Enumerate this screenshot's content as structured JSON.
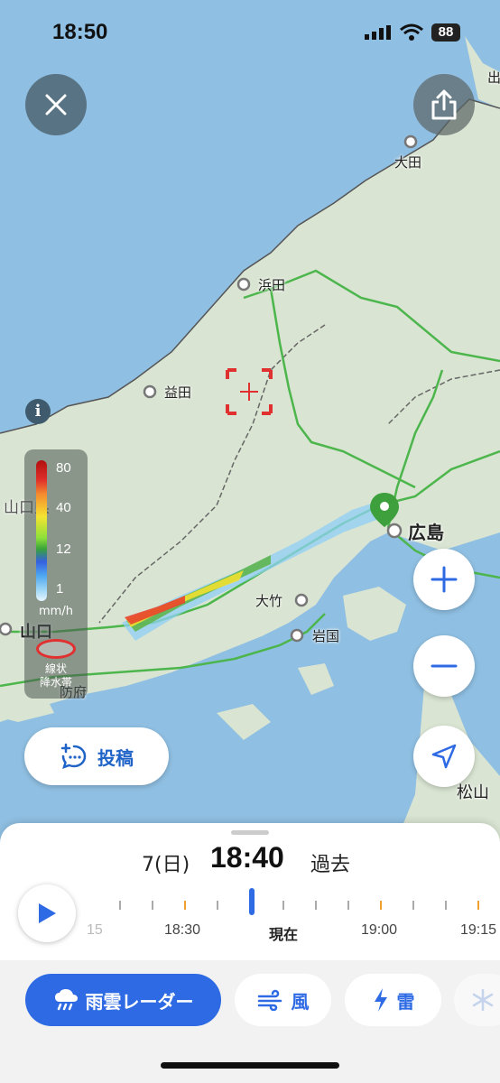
{
  "status_bar": {
    "time": "18:50",
    "battery": "88"
  },
  "map": {
    "cities": [
      {
        "name": "大田"
      },
      {
        "name": "浜田"
      },
      {
        "name": "益田"
      },
      {
        "name": "広島"
      },
      {
        "name": "大竹"
      },
      {
        "name": "岩国"
      },
      {
        "name": "山口"
      },
      {
        "name": "山口県"
      },
      {
        "name": "防府"
      },
      {
        "name": "松山"
      },
      {
        "name": "出"
      }
    ]
  },
  "legend": {
    "ticks": [
      "80",
      "40",
      "12",
      "1"
    ],
    "unit": "mm/h",
    "linear_label_1": "線状",
    "linear_label_2": "降水帯"
  },
  "post_button": {
    "label": "投稿"
  },
  "timeline": {
    "date": "7(日)",
    "time": "18:40",
    "state": "過去",
    "labels": [
      "15",
      "18:30",
      "現在",
      "19:00",
      "19:15"
    ]
  },
  "tabs": [
    {
      "label": "雨雲レーダー",
      "icon": "rain-cloud-icon",
      "active": true
    },
    {
      "label": "風",
      "icon": "wind-icon",
      "active": false
    },
    {
      "label": "雷",
      "icon": "lightning-icon",
      "active": false
    },
    {
      "label": "",
      "icon": "snowflake-icon",
      "active": false
    }
  ],
  "colors": {
    "accent": "#2d6ae3",
    "sea": "#8fbfe2",
    "land": "#d9e4d2",
    "road": "#4cb64c"
  }
}
